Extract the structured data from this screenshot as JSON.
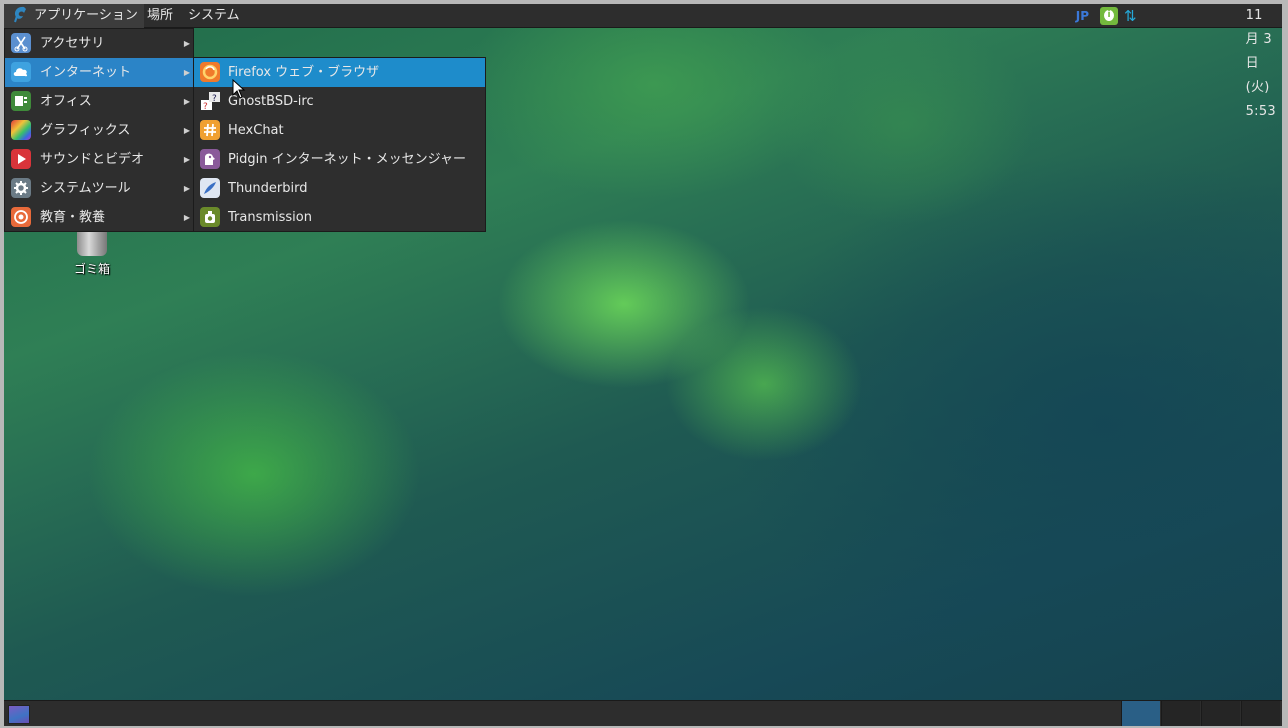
{
  "top_panel": {
    "applications_label": "アプリケーション",
    "places_label": "場所",
    "system_label": "システム",
    "keyboard_layout": "JP",
    "clock": "11月 3日 (火)  5:53"
  },
  "main_menu": {
    "items": [
      {
        "label": "アクセサリ",
        "icon": "accessories-icon",
        "color": "#5b8fcf"
      },
      {
        "label": "インターネット",
        "icon": "internet-icon",
        "color": "#3ea2e0",
        "highlighted": true
      },
      {
        "label": "オフィス",
        "icon": "office-icon",
        "color": "#3f8a3a"
      },
      {
        "label": "グラフィックス",
        "icon": "graphics-icon",
        "color": "#c94fb8"
      },
      {
        "label": "サウンドとビデオ",
        "icon": "sound-video-icon",
        "color": "#d9343a"
      },
      {
        "label": "システムツール",
        "icon": "system-tools-icon",
        "color": "#6b7b86"
      },
      {
        "label": "教育・教養",
        "icon": "education-icon",
        "color": "#e86a3a"
      }
    ]
  },
  "internet_submenu": {
    "items": [
      {
        "label": "Firefox ウェブ・ブラウザ",
        "icon": "firefox-icon",
        "color": "#f07a2b",
        "highlighted": true
      },
      {
        "label": "GhostBSD-irc",
        "icon": "irc-icon",
        "color": "#555555"
      },
      {
        "label": "HexChat",
        "icon": "hexchat-icon",
        "color": "#f0a030"
      },
      {
        "label": "Pidgin インターネット・メッセンジャー",
        "icon": "pidgin-icon",
        "color": "#8a5a9a"
      },
      {
        "label": "Thunderbird",
        "icon": "thunderbird-icon",
        "color": "#3a6fc4"
      },
      {
        "label": "Transmission",
        "icon": "transmission-icon",
        "color": "#6a8a2a"
      }
    ]
  },
  "desktop": {
    "trash_label": "ゴミ箱"
  },
  "bottom_panel": {
    "active_workspace": 1,
    "workspace_count": 4
  },
  "colors": {
    "panel": "#2d2d2d",
    "menu_highlight": "#2b84c7",
    "submenu_highlight": "#1e8ccb"
  }
}
